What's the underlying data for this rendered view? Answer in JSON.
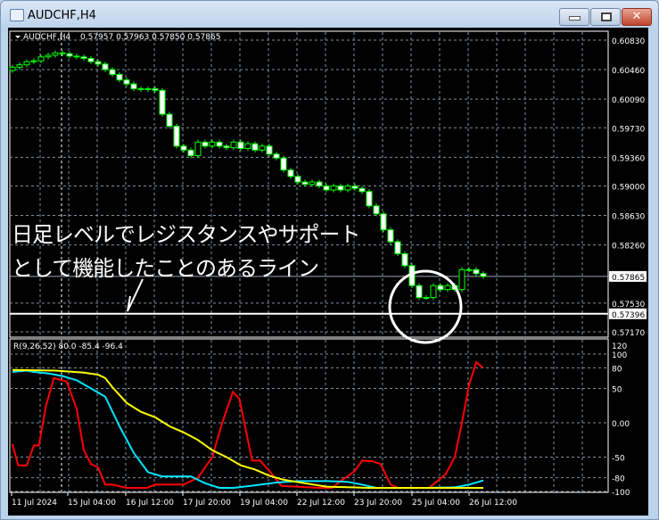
{
  "window": {
    "title": "AUDCHF,H4"
  },
  "colors": {
    "bull_outline": "#00ff00",
    "bear_body": "#ffffff",
    "grid": "#8090a0",
    "red": "#ff0000",
    "cyan": "#00e5ff",
    "yellow": "#ffff00",
    "axis_text": "#ffffff"
  },
  "icons": {
    "app": "chart-window-icon",
    "minimize": "minimize-icon",
    "maximize": "maximize-icon",
    "close": "close-icon",
    "menu": "triangle-down-icon"
  },
  "chart_data": [
    {
      "type": "candlestick",
      "symbol_label": "AUDCHF,H4",
      "ohlc_label": "0.57957 0.57963 0.57850 0.57865",
      "ylim": [
        0.5717,
        0.6083
      ],
      "y_ticks": [
        "0.60830",
        "0.60460",
        "0.60090",
        "0.59730",
        "0.59360",
        "0.59000",
        "0.58630",
        "0.58260",
        "0.57530",
        "0.57170"
      ],
      "current_price_label": "0.57865",
      "current_price": 0.57865,
      "hline_label": "0.57396",
      "hline": 0.57396,
      "x_ticks": [
        "11 Jul 2024",
        "15 Jul 04:00",
        "16 Jul 12:00",
        "17 Jul 20:00",
        "19 Jul 04:00",
        "22 Jul 12:00",
        "23 Jul 20:00",
        "25 Jul 04:00",
        "26 Jul 12:00"
      ],
      "closes": [
        0.6049,
        0.6052,
        0.6056,
        0.6057,
        0.6062,
        0.6064,
        0.6067,
        0.6066,
        0.6063,
        0.6062,
        0.606,
        0.6056,
        0.6053,
        0.6046,
        0.604,
        0.6033,
        0.6028,
        0.6022,
        0.6021,
        0.6022,
        0.602,
        0.599,
        0.5975,
        0.595,
        0.5945,
        0.5938,
        0.5955,
        0.595,
        0.5955,
        0.595,
        0.5948,
        0.5955,
        0.5947,
        0.5953,
        0.5945,
        0.595,
        0.594,
        0.5935,
        0.592,
        0.5912,
        0.5905,
        0.5902,
        0.5905,
        0.59,
        0.5895,
        0.59,
        0.5895,
        0.59,
        0.5897,
        0.5893,
        0.5875,
        0.5865,
        0.5845,
        0.583,
        0.5815,
        0.58,
        0.5775,
        0.576,
        0.576,
        0.5775,
        0.577,
        0.5775,
        0.577,
        0.5795,
        0.5795,
        0.579,
        0.57865
      ],
      "annotations": {
        "line1": "日足レベルでレジスタンスやサポート",
        "line2": "として機能したことのあるライン"
      }
    },
    {
      "type": "line",
      "indicator_label": "R(9,26,52) 80.0 -85.4 -96.4",
      "ylim": [
        -100,
        120
      ],
      "y_ticks": [
        "120",
        "100",
        "80",
        "50",
        "0.00",
        "-50",
        "-80",
        "-100"
      ],
      "series": [
        {
          "color": "#ff0000",
          "points": [
            [
              0,
              -31
            ],
            [
              0.8,
              -62
            ],
            [
              2,
              -62
            ],
            [
              3,
              -33
            ],
            [
              3.7,
              -33
            ],
            [
              4.7,
              25
            ],
            [
              5.8,
              65
            ],
            [
              7.6,
              60
            ],
            [
              9,
              20
            ],
            [
              10,
              -40
            ],
            [
              11,
              -60
            ],
            [
              12,
              -65
            ],
            [
              13,
              -90
            ],
            [
              14,
              -90
            ],
            [
              16,
              -98
            ],
            [
              18.8,
              -98
            ],
            [
              20,
              -90
            ],
            [
              24,
              -90
            ],
            [
              26,
              -80
            ],
            [
              28,
              -50
            ],
            [
              29.4,
              0
            ],
            [
              30.9,
              45
            ],
            [
              31.8,
              35
            ],
            [
              33.6,
              -55
            ],
            [
              34.7,
              -55
            ],
            [
              36,
              -70
            ],
            [
              37.7,
              -92
            ],
            [
              39.8,
              -93
            ],
            [
              43,
              -95
            ],
            [
              44.8,
              -98
            ],
            [
              46,
              -85
            ],
            [
              48,
              -70
            ],
            [
              49,
              -55
            ],
            [
              50.4,
              -56
            ],
            [
              51.6,
              -60
            ],
            [
              53,
              -90
            ],
            [
              54,
              -98
            ],
            [
              58.4,
              -98
            ],
            [
              60.7,
              -75
            ],
            [
              62,
              -50
            ],
            [
              63,
              0
            ],
            [
              64,
              55
            ],
            [
              65,
              88
            ],
            [
              66,
              80
            ]
          ]
        },
        {
          "color": "#00e5ff",
          "points": [
            [
              0,
              74
            ],
            [
              2,
              76
            ],
            [
              3,
              74
            ],
            [
              5,
              72
            ],
            [
              7,
              68
            ],
            [
              9,
              62
            ],
            [
              11,
              50
            ],
            [
              13,
              38
            ],
            [
              15,
              -5
            ],
            [
              17,
              -44
            ],
            [
              19,
              -72
            ],
            [
              21,
              -78
            ],
            [
              25,
              -78
            ],
            [
              27,
              -88
            ],
            [
              29,
              -96
            ],
            [
              31,
              -95
            ],
            [
              34,
              -91
            ],
            [
              37,
              -87
            ],
            [
              40,
              -85
            ],
            [
              44,
              -85
            ],
            [
              47,
              -86
            ],
            [
              49,
              -90
            ],
            [
              51,
              -95
            ],
            [
              58,
              -96
            ],
            [
              62,
              -94
            ],
            [
              64,
              -90
            ],
            [
              66,
              -84
            ]
          ]
        },
        {
          "color": "#ffff00",
          "points": [
            [
              0,
              77
            ],
            [
              6,
              76
            ],
            [
              10,
              73
            ],
            [
              12,
              70
            ],
            [
              13,
              65
            ],
            [
              14,
              52
            ],
            [
              16,
              29
            ],
            [
              18,
              16
            ],
            [
              20,
              8
            ],
            [
              22,
              -5
            ],
            [
              24,
              -14
            ],
            [
              26,
              -25
            ],
            [
              28,
              -40
            ],
            [
              30,
              -50
            ],
            [
              32,
              -62
            ],
            [
              34,
              -68
            ],
            [
              36,
              -77
            ],
            [
              38,
              -83
            ],
            [
              41,
              -88
            ],
            [
              44,
              -93
            ],
            [
              50,
              -95
            ],
            [
              58,
              -96
            ],
            [
              63,
              -96
            ],
            [
              66,
              -95
            ]
          ]
        }
      ]
    }
  ]
}
